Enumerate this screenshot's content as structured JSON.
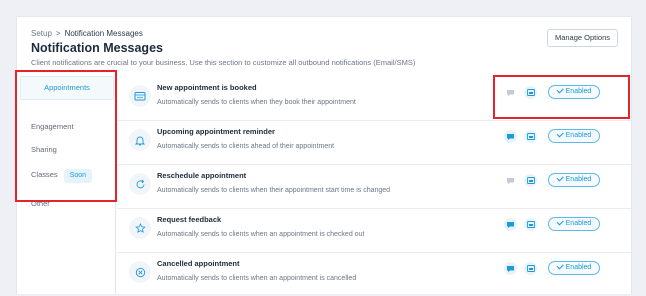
{
  "breadcrumb": {
    "root": "Setup",
    "separator": ">",
    "current": "Notification Messages"
  },
  "page": {
    "title": "Notification Messages",
    "subtitle": "Client notifications are crucial to your business. Use this section to customize all outbound notifications (Email/SMS)"
  },
  "header": {
    "manage_options_label": "Manage Options"
  },
  "sidebar": {
    "items": [
      {
        "label": "Appointments",
        "active": true
      },
      {
        "label": "Engagement"
      },
      {
        "label": "Sharing"
      },
      {
        "label": "Classes",
        "badge": "Soon"
      },
      {
        "label": "Other"
      }
    ]
  },
  "notifications": [
    {
      "title": "New appointment is booked",
      "description": "Automatically sends to clients when they book their appointment",
      "status": "Enabled",
      "icon": "calendar-icon",
      "sms_active": false
    },
    {
      "title": "Upcoming appointment reminder",
      "description": "Automatically sends to clients ahead of their appointment",
      "status": "Enabled",
      "icon": "bell-icon",
      "sms_active": true
    },
    {
      "title": "Reschedule appointment",
      "description": "Automatically sends to clients when their appointment start time is changed",
      "status": "Enabled",
      "icon": "refresh-icon",
      "sms_active": false
    },
    {
      "title": "Request feedback",
      "description": "Automatically sends to clients when an appointment is checked out",
      "status": "Enabled",
      "icon": "star-icon",
      "sms_active": true
    },
    {
      "title": "Cancelled appointment",
      "description": "Automatically sends to clients when an appointment is cancelled",
      "status": "Enabled",
      "icon": "cancel-icon",
      "sms_active": true
    }
  ],
  "colors": {
    "accent": "#1c9bd8",
    "highlight_box": "#e5232a",
    "background": "#eef0f5"
  }
}
